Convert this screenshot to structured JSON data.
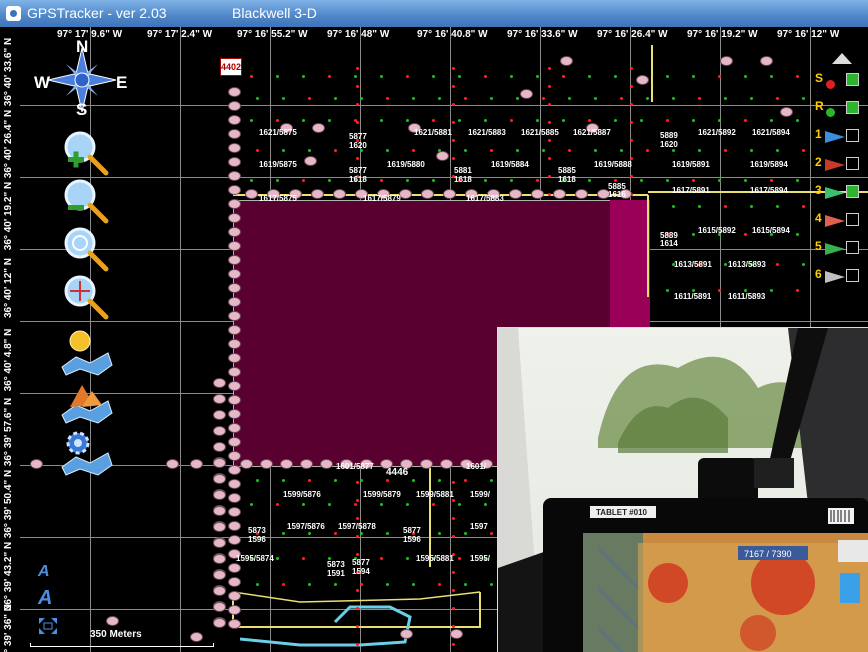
{
  "titlebar": {
    "app": "GPSTracker  -  ver 2.03",
    "subtitle": "Blackwell 3-D"
  },
  "compass": {
    "n": "N",
    "e": "E",
    "s": "S",
    "w": "W"
  },
  "longitudes": [
    "97° 17' 9.6\" W",
    "97° 17' 2.4\" W",
    "97° 16' 55.2\" W",
    "97° 16' 48\" W",
    "97° 16' 40.8\" W",
    "97° 16' 33.6\" W",
    "97° 16' 26.4\" W",
    "97° 16' 19.2\" W",
    "97° 16' 12\" W"
  ],
  "latitudes": [
    "36° 40' 33.6\" N",
    "36° 40' 26.4\" N",
    "36° 40' 19.2\" N",
    "36° 40' 12\" N",
    "36° 40' 4.8\" N",
    "36° 39' 57.6\" N",
    "36° 39' 50.4\" N",
    "36° 39' 43.2\" N",
    "36° 39' 36\" N"
  ],
  "map_labels": {
    "a": "1621/5875",
    "b": "5877",
    "b2": "1620",
    "c": "1621/5881",
    "d": "1621/5883",
    "e": "1621/5885",
    "f": "1621/5887",
    "g": "5889",
    "g2": "1620",
    "h": "1621/5892",
    "i": "1621/5894",
    "j": "1619/5875",
    "k": "5877",
    "k2": "1618",
    "l": "1619/5880",
    "m": "5881",
    "m2": "1618",
    "n": "1619/5884",
    "o": "5885",
    "o2": "1618",
    "p": "1619/5888",
    "q": "1619/5891",
    "r": "1619/5894",
    "s": "1617/5875",
    "t": "1617/5879",
    "u": "1617/5883",
    "v": "5885",
    "v2": "1616",
    "w": "1617/5891",
    "x": "1617/5894",
    "y": "5889",
    "y2": "1614",
    "z": "1615/5892",
    "aa": "1615/5894",
    "ab": "1613/5891",
    "ac": "1613/5893",
    "ad": "1611/5891",
    "ae": "1611/5893",
    "af": "1601/5877",
    "ag": "4446",
    "ah": "1601/",
    "ai": "1599/5876",
    "aj": "1599/5879",
    "ak": "1599/5881",
    "al": "1599/",
    "am": "5873",
    "am2": "1596",
    "an": "1597/5876",
    "ao": "1597/5878",
    "ap": "5877",
    "ap2": "1596",
    "aq": "1597",
    "ar": "1595/5874",
    "as": "5873",
    "as2": "1591",
    "at": "5877",
    "at2": "1594",
    "au": "1595/5881",
    "av": "1595/",
    "unit": "4402"
  },
  "side_panel": [
    {
      "label": "S",
      "checked": true
    },
    {
      "label": "R",
      "checked": true
    },
    {
      "label": "1",
      "checked": false
    },
    {
      "label": "2",
      "checked": false
    },
    {
      "label": "3",
      "checked": true
    },
    {
      "label": "4",
      "checked": false
    },
    {
      "label": "5",
      "checked": false
    },
    {
      "label": "6",
      "checked": false
    }
  ],
  "scale": {
    "label": "350 Meters"
  },
  "inset": {
    "tablet_label": "TABLET #010",
    "screen_value": "7167 / 7390"
  },
  "colors": {
    "field": "#5a0030",
    "field_hl": "#9a0058",
    "road": "#e8e070",
    "track": "#6ad0e8"
  }
}
